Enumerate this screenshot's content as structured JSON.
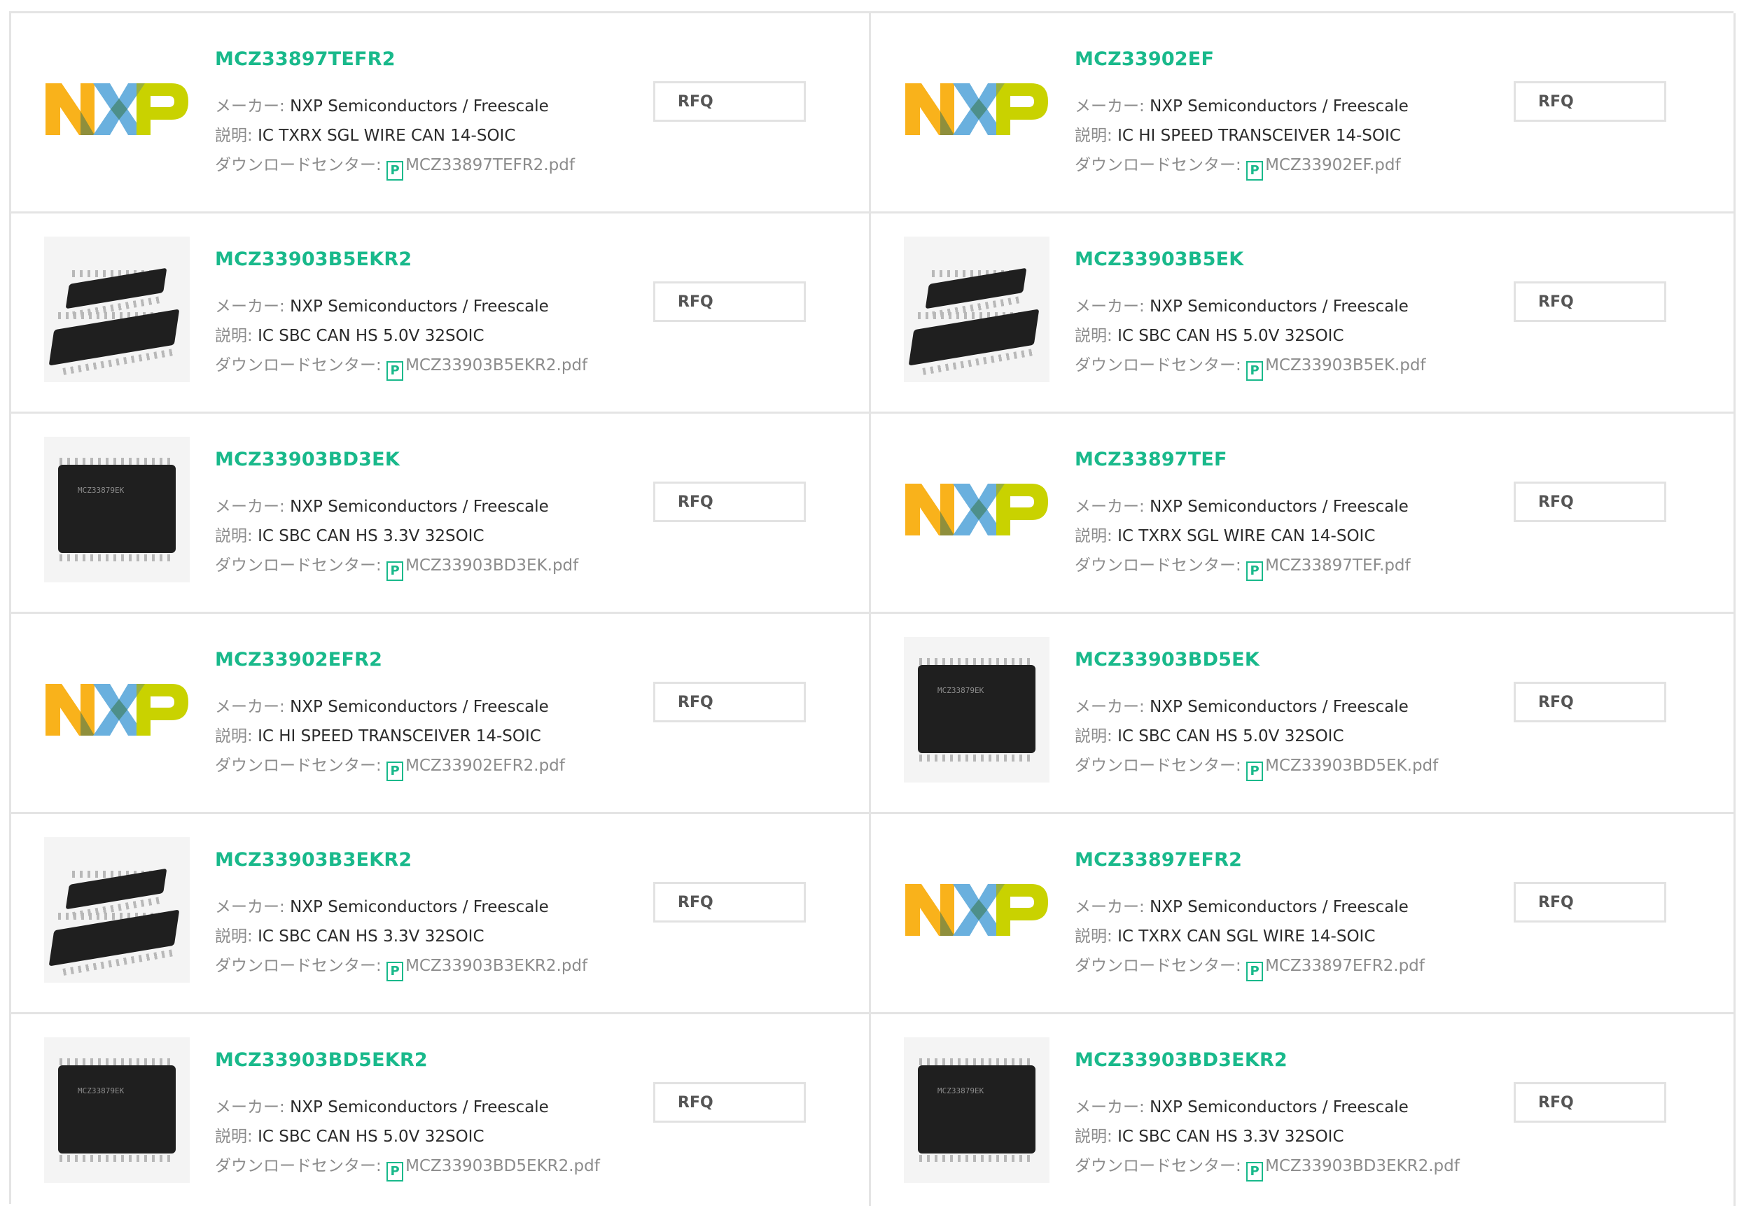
{
  "labels": {
    "maker": "メーカー: ",
    "description": "説明: ",
    "download": "ダウンロードセンター: "
  },
  "pdf_icon_glyph": "P",
  "accent_color": "#19b98b",
  "items": [
    {
      "part": "MCZ33897TEFR2",
      "maker": "NXP Semiconductors / Freescale",
      "description": "IC TXRX SGL WIRE CAN 14-SOIC",
      "pdf": "MCZ33897TEFR2.pdf",
      "rfq": "RFQ",
      "image": "nxp-logo"
    },
    {
      "part": "MCZ33902EF",
      "maker": "NXP Semiconductors / Freescale",
      "description": "IC HI SPEED TRANSCEIVER 14-SOIC",
      "pdf": "MCZ33902EF.pdf",
      "rfq": "RFQ",
      "image": "nxp-logo"
    },
    {
      "part": "MCZ33903B5EKR2",
      "maker": "NXP Semiconductors / Freescale",
      "description": "IC SBC CAN HS 5.0V 32SOIC",
      "pdf": "MCZ33903B5EKR2.pdf",
      "rfq": "RFQ",
      "image": "chip-pair"
    },
    {
      "part": "MCZ33903B5EK",
      "maker": "NXP Semiconductors / Freescale",
      "description": "IC SBC CAN HS 5.0V 32SOIC",
      "pdf": "MCZ33903B5EK.pdf",
      "rfq": "RFQ",
      "image": "chip-pair"
    },
    {
      "part": "MCZ33903BD3EK",
      "maker": "NXP Semiconductors / Freescale",
      "description": "IC SBC CAN HS 3.3V 32SOIC",
      "pdf": "MCZ33903BD3EK.pdf",
      "rfq": "RFQ",
      "image": "chip-single"
    },
    {
      "part": "MCZ33897TEF",
      "maker": "NXP Semiconductors / Freescale",
      "description": "IC TXRX SGL WIRE CAN 14-SOIC",
      "pdf": "MCZ33897TEF.pdf",
      "rfq": "RFQ",
      "image": "nxp-logo"
    },
    {
      "part": "MCZ33902EFR2",
      "maker": "NXP Semiconductors / Freescale",
      "description": "IC HI SPEED TRANSCEIVER 14-SOIC",
      "pdf": "MCZ33902EFR2.pdf",
      "rfq": "RFQ",
      "image": "nxp-logo"
    },
    {
      "part": "MCZ33903BD5EK",
      "maker": "NXP Semiconductors / Freescale",
      "description": "IC SBC CAN HS 5.0V 32SOIC",
      "pdf": "MCZ33903BD5EK.pdf",
      "rfq": "RFQ",
      "image": "chip-single"
    },
    {
      "part": "MCZ33903B3EKR2",
      "maker": "NXP Semiconductors / Freescale",
      "description": "IC SBC CAN HS 3.3V 32SOIC",
      "pdf": "MCZ33903B3EKR2.pdf",
      "rfq": "RFQ",
      "image": "chip-pair"
    },
    {
      "part": "MCZ33897EFR2",
      "maker": "NXP Semiconductors / Freescale",
      "description": "IC TXRX CAN SGL WIRE 14-SOIC",
      "pdf": "MCZ33897EFR2.pdf",
      "rfq": "RFQ",
      "image": "nxp-logo"
    },
    {
      "part": "MCZ33903BD5EKR2",
      "maker": "NXP Semiconductors / Freescale",
      "description": "IC SBC CAN HS 5.0V 32SOIC",
      "pdf": "MCZ33903BD5EKR2.pdf",
      "rfq": "RFQ",
      "image": "chip-single"
    },
    {
      "part": "MCZ33903BD3EKR2",
      "maker": "NXP Semiconductors / Freescale",
      "description": "IC SBC CAN HS 3.3V 32SOIC",
      "pdf": "MCZ33903BD3EKR2.pdf",
      "rfq": "RFQ",
      "image": "chip-single"
    }
  ]
}
